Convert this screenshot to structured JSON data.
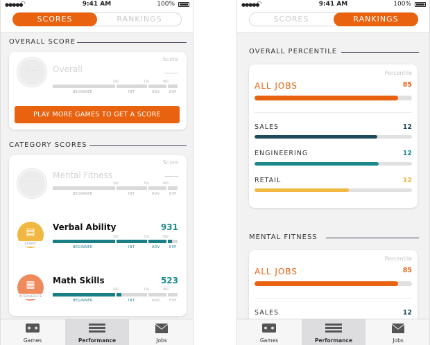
{
  "status_bar": {
    "time": "9:41 AM",
    "battery": "100%"
  },
  "segments": {
    "scores": "SCORES",
    "rankings": "RANKINGS"
  },
  "left_screen": {
    "overall_section_title": "OVERALL SCORE",
    "overall_card": {
      "score_header": "Score",
      "name": "Overall",
      "ticks": [
        "500",
        "750",
        "900"
      ],
      "levels": [
        "BEGINNER",
        "INT",
        "ADV",
        "EXP"
      ],
      "cta_label": "PLAY MORE GAMES TO GET A SCORE"
    },
    "category_section_title": "CATEGORY SCORES",
    "category_card": {
      "score_header": "Score",
      "items": [
        {
          "name": "Mental Fitness",
          "score": "",
          "badge_text": "",
          "progress": 0
        },
        {
          "name": "Verbal Ability",
          "score": "931",
          "badge_text": "EXPERT",
          "progress": 0.93
        },
        {
          "name": "Math Skills",
          "score": "523",
          "badge_text": "INTERMEDIATE",
          "progress": 0.52
        }
      ]
    }
  },
  "right_screen": {
    "overall_section_title": "OVERALL PERCENTILE",
    "overall_card": {
      "header": "Percentile",
      "rows": [
        {
          "label": "ALL JOBS",
          "value": "85",
          "percent": 0.91,
          "color": "#e8620f"
        },
        {
          "label": "SALES",
          "value": "12",
          "percent": 0.78,
          "color": "#1d4a5a"
        },
        {
          "label": "ENGINEERING",
          "value": "12",
          "percent": 0.79,
          "color": "#1a8a8f"
        },
        {
          "label": "RETAIL",
          "value": "12",
          "percent": 0.6,
          "color": "#f0b840"
        }
      ]
    },
    "mental_section_title": "MENTAL FITNESS",
    "mental_card": {
      "header": "Percentile",
      "rows": [
        {
          "label": "ALL JOBS",
          "value": "85",
          "percent": 0.91,
          "color": "#e8620f"
        },
        {
          "label": "SALES",
          "value": "12",
          "percent": 0.78,
          "color": "#1d4a5a"
        }
      ]
    }
  },
  "tab_bar": {
    "tabs": [
      {
        "label": "Games",
        "icon": "gamepad-icon"
      },
      {
        "label": "Performance",
        "icon": "bars-icon"
      },
      {
        "label": "Jobs",
        "icon": "envelope-icon"
      }
    ],
    "active": "Performance"
  },
  "colors": {
    "accent": "#e8620f",
    "teal": "#1a8a8f",
    "navy": "#1d4a5a",
    "yellow": "#f0b840",
    "track": "#d9d9d9"
  }
}
